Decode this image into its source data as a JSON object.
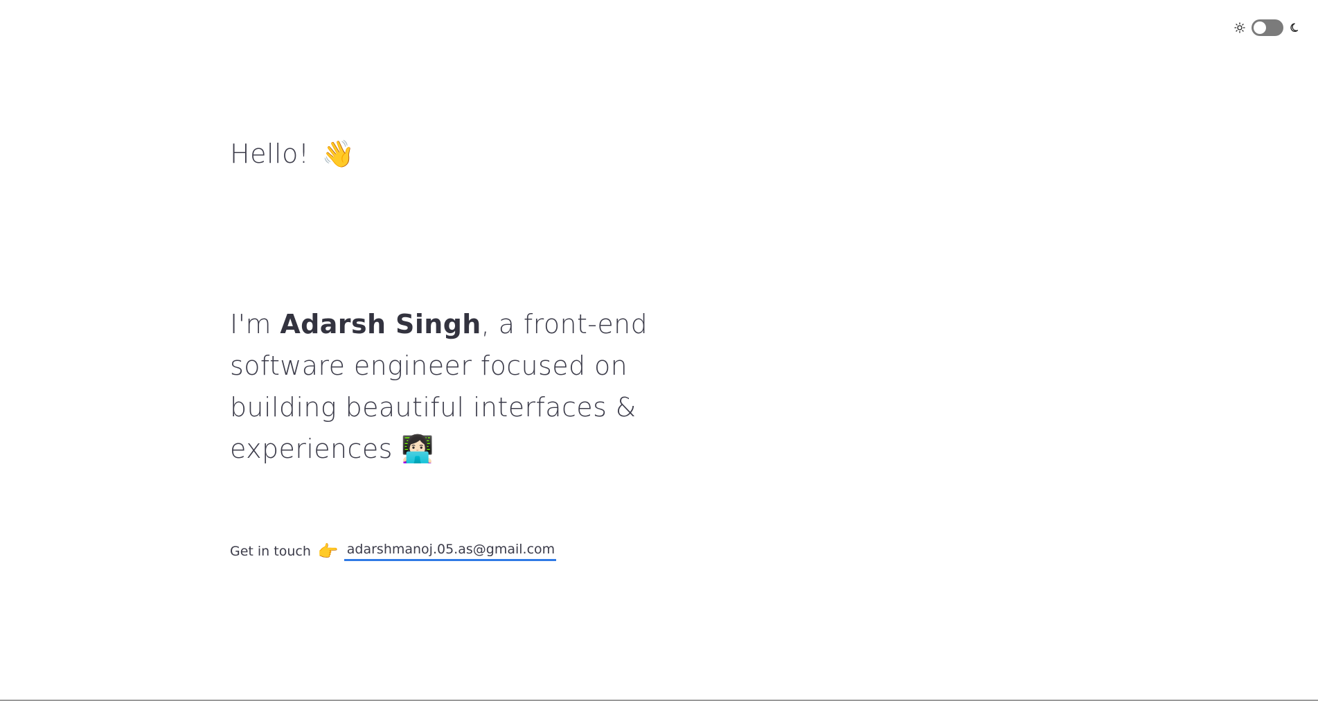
{
  "theme_toggle": {
    "light_icon": "sun-icon",
    "dark_icon": "moon-icon",
    "state": "light"
  },
  "hero": {
    "greeting": "Hello!",
    "greeting_emoji": "👋",
    "intro_prefix": "I'm ",
    "name": "Adarsh Singh",
    "intro_suffix": ", a front-end software engineer focused on building beautiful interfaces & experiences",
    "intro_emoji": "👩🏻‍💻"
  },
  "contact": {
    "label": "Get in touch",
    "pointer_emoji": "👉",
    "email": "adarshmanoj.05.as@gmail.com"
  },
  "colors": {
    "text": "#3c3c4a",
    "link_underline": "#2f7ae5",
    "toggle_track": "#7b7b7b"
  }
}
